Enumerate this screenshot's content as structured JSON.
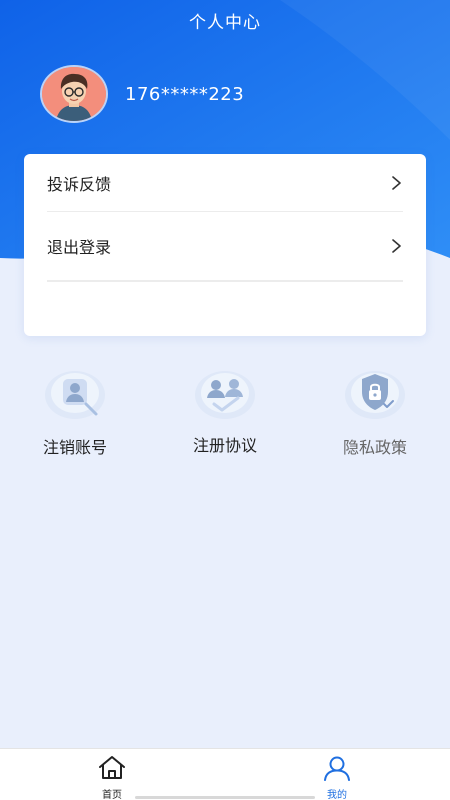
{
  "header": {
    "title": "个人中心"
  },
  "profile": {
    "phone": "176*****223",
    "avatar_icon": "avatar-icon"
  },
  "menu": {
    "items": [
      {
        "label": "投诉反馈",
        "icon": "chevron-right-icon"
      },
      {
        "label": "退出登录",
        "icon": "chevron-right-icon"
      }
    ]
  },
  "features": [
    {
      "label": "注销账号",
      "icon": "user-id-icon"
    },
    {
      "label": "注册协议",
      "icon": "users-agreement-icon"
    },
    {
      "label": "隐私政策",
      "icon": "shield-lock-icon"
    }
  ],
  "tabs": [
    {
      "label": "首页",
      "icon": "home-icon"
    },
    {
      "label": "我的",
      "icon": "user-icon"
    }
  ],
  "colors": {
    "primary": "#1f6fe0",
    "background": "#e9effc"
  }
}
